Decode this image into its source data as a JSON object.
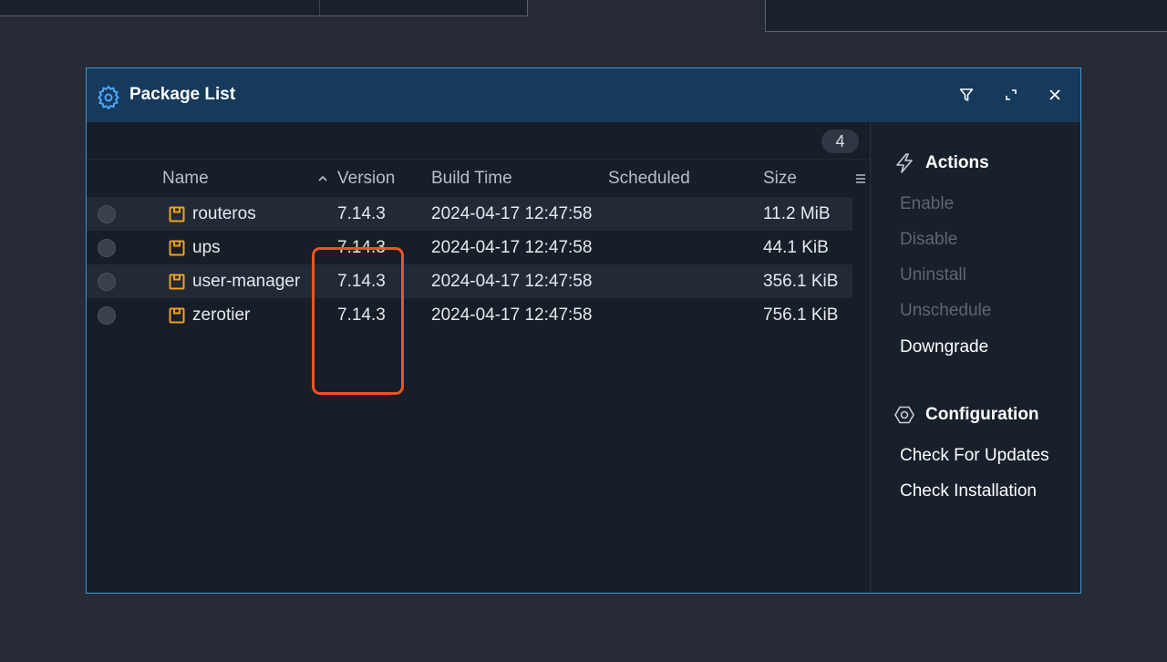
{
  "window": {
    "title": "Package List",
    "count": "4"
  },
  "table": {
    "columns": {
      "name": "Name",
      "version": "Version",
      "build_time": "Build Time",
      "scheduled": "Scheduled",
      "size": "Size"
    },
    "sorted_column": "version",
    "sort_direction": "ascending",
    "rows": [
      {
        "name": "routeros",
        "version": "7.14.3",
        "build_time": "2024-04-17 12:47:58",
        "scheduled": "",
        "size": "11.2 MiB"
      },
      {
        "name": "ups",
        "version": "7.14.3",
        "build_time": "2024-04-17 12:47:58",
        "scheduled": "",
        "size": "44.1 KiB"
      },
      {
        "name": "user-manager",
        "version": "7.14.3",
        "build_time": "2024-04-17 12:47:58",
        "scheduled": "",
        "size": "356.1 KiB"
      },
      {
        "name": "zerotier",
        "version": "7.14.3",
        "build_time": "2024-04-17 12:47:58",
        "scheduled": "",
        "size": "756.1 KiB"
      }
    ]
  },
  "sidebar": {
    "actions_title": "Actions",
    "actions": [
      {
        "label": "Enable",
        "enabled": false
      },
      {
        "label": "Disable",
        "enabled": false
      },
      {
        "label": "Uninstall",
        "enabled": false
      },
      {
        "label": "Unschedule",
        "enabled": false
      },
      {
        "label": "Downgrade",
        "enabled": true
      }
    ],
    "config_title": "Configuration",
    "config_actions": [
      {
        "label": "Check For Updates",
        "enabled": true
      },
      {
        "label": "Check Installation",
        "enabled": true
      }
    ]
  },
  "icons": {
    "title": "gear-icon",
    "filter": "filter-icon",
    "maximize": "maximize-icon",
    "close": "close-icon",
    "package": "package-icon",
    "actions": "lightning-icon",
    "configuration": "hexagon-icon",
    "sort": "chevron-up-icon",
    "columns": "menu-icon"
  },
  "colors": {
    "accent": "#3a95d6",
    "titlebar": "#163a5c",
    "package_icon": "#f0a020",
    "highlight": "#f0531e"
  }
}
